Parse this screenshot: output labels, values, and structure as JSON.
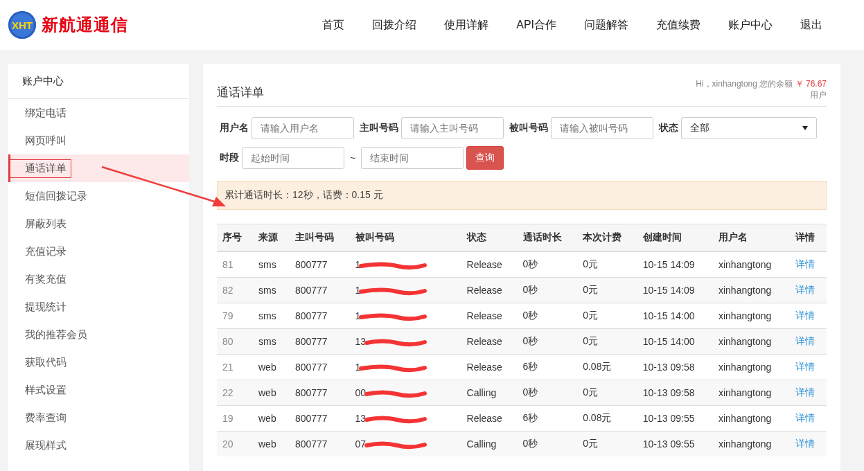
{
  "logo": {
    "mark": "XHT",
    "name": "新航通通信"
  },
  "nav": [
    {
      "label": "首页"
    },
    {
      "label": "回拨介绍"
    },
    {
      "label": "使用详解"
    },
    {
      "label": "API合作"
    },
    {
      "label": "问题解答"
    },
    {
      "label": "充值续费"
    },
    {
      "label": "账户中心"
    },
    {
      "label": "退出"
    }
  ],
  "sidebar": {
    "title": "账户中心",
    "items": [
      {
        "label": "绑定电话",
        "selected": false,
        "circled": false
      },
      {
        "label": "网页呼叫",
        "selected": false,
        "circled": false
      },
      {
        "label": "通话详单",
        "selected": true,
        "circled": true
      },
      {
        "label": "短信回拨记录",
        "selected": false,
        "circled": false
      },
      {
        "label": "屏蔽列表",
        "selected": false,
        "circled": false
      },
      {
        "label": "充值记录",
        "selected": false,
        "circled": false
      },
      {
        "label": "有奖充值",
        "selected": false,
        "circled": false
      },
      {
        "label": "提现统计",
        "selected": false,
        "circled": false
      },
      {
        "label": "我的推荐会员",
        "selected": false,
        "circled": false
      },
      {
        "label": "获取代码",
        "selected": false,
        "circled": false
      },
      {
        "label": "样式设置",
        "selected": false,
        "circled": false
      },
      {
        "label": "费率查询",
        "selected": false,
        "circled": false
      },
      {
        "label": "展现样式",
        "selected": false,
        "circled": false
      }
    ]
  },
  "panel": {
    "title": "通话详单",
    "greeting": "Hi，xinhangtong 您的余额",
    "balance": "￥ 76.67",
    "role": "用户",
    "filters": [
      {
        "kind": "input",
        "label": "用户名",
        "placeholder": "请输入用户名"
      },
      {
        "kind": "input",
        "label": "主叫号码",
        "placeholder": "请输入主叫号码"
      },
      {
        "kind": "input",
        "label": "被叫号码",
        "placeholder": "请输入被叫号码"
      },
      {
        "kind": "select",
        "label": "状态",
        "value": "全部"
      }
    ],
    "period": {
      "label": "时段",
      "start_placeholder": "起始时间",
      "separator": "~",
      "end_placeholder": "结束时间"
    },
    "query_button": "查询",
    "summary": "累计通话时长：12秒，话费：0.15 元",
    "table": {
      "columns": [
        "序号",
        "来源",
        "主叫号码",
        "被叫号码",
        "状态",
        "通话时长",
        "本次计费",
        "创建时间",
        "用户名",
        "详情"
      ],
      "rows": [
        {
          "id": "81",
          "source": "sms",
          "caller": "800777",
          "callee": "1",
          "status": "Release",
          "duration": "0秒",
          "fee": "0元",
          "created": "10-15 14:09",
          "user": "xinhangtong",
          "link": "详情"
        },
        {
          "id": "82",
          "source": "sms",
          "caller": "800777",
          "callee": "1",
          "status": "Release",
          "duration": "0秒",
          "fee": "0元",
          "created": "10-15 14:09",
          "user": "xinhangtong",
          "link": "详情"
        },
        {
          "id": "79",
          "source": "sms",
          "caller": "800777",
          "callee": "1",
          "status": "Release",
          "duration": "0秒",
          "fee": "0元",
          "created": "10-15 14:00",
          "user": "xinhangtong",
          "link": "详情"
        },
        {
          "id": "80",
          "source": "sms",
          "caller": "800777",
          "callee": "13",
          "status": "Release",
          "duration": "0秒",
          "fee": "0元",
          "created": "10-15 14:00",
          "user": "xinhangtong",
          "link": "详情"
        },
        {
          "id": "21",
          "source": "web",
          "caller": "800777",
          "callee": "1",
          "status": "Release",
          "duration": "6秒",
          "fee": "0.08元",
          "created": "10-13 09:58",
          "user": "xinhangtong",
          "link": "详情"
        },
        {
          "id": "22",
          "source": "web",
          "caller": "800777",
          "callee": "00",
          "status": "Calling",
          "duration": "0秒",
          "fee": "0元",
          "created": "10-13 09:58",
          "user": "xinhangtong",
          "link": "详情"
        },
        {
          "id": "19",
          "source": "web",
          "caller": "800777",
          "callee": "13",
          "status": "Release",
          "duration": "6秒",
          "fee": "0.08元",
          "created": "10-13 09:55",
          "user": "xinhangtong",
          "link": "详情"
        },
        {
          "id": "20",
          "source": "web",
          "caller": "800777",
          "callee": "07",
          "status": "Calling",
          "duration": "0秒",
          "fee": "0元",
          "created": "10-13 09:55",
          "user": "xinhangtong",
          "link": "详情"
        }
      ]
    }
  }
}
